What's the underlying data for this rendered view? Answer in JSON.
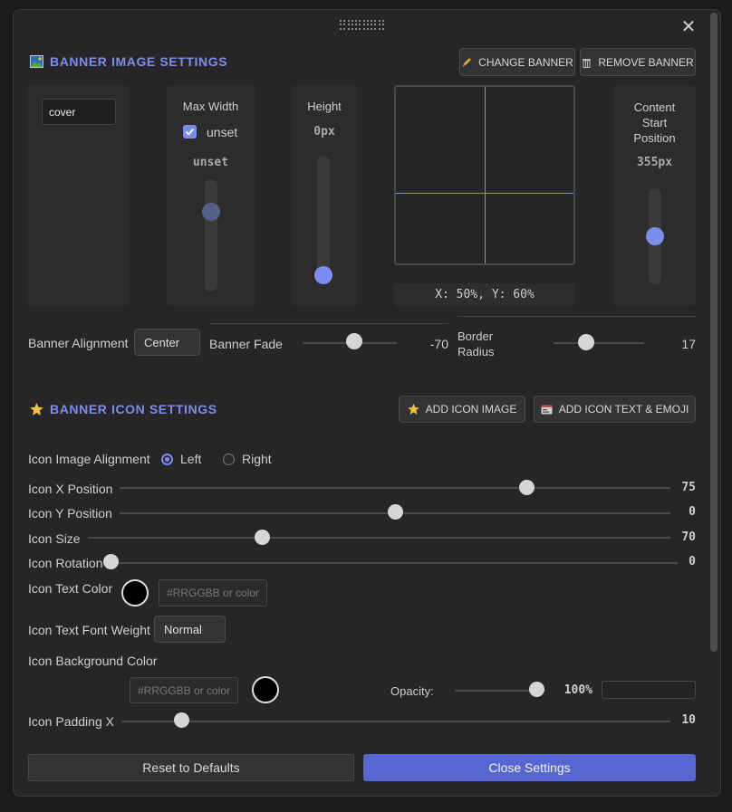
{
  "banner_image": {
    "title": "BANNER IMAGE SETTINGS",
    "change_label": "CHANGE BANNER",
    "remove_label": "REMOVE BANNER",
    "fit_value": "cover",
    "max_width": {
      "label": "Max Width",
      "checkbox_label": "unset",
      "checked": true,
      "value": "unset",
      "level": 0.75
    },
    "height": {
      "label": "Height",
      "value": "0px",
      "level": 0.0
    },
    "position": {
      "readout": "X: 50%, Y: 60%",
      "x": 50,
      "y": 60
    },
    "content_start": {
      "label_line1": "Content",
      "label_line2": "Start",
      "label_line3": "Position",
      "value": "355px",
      "level": 0.5
    },
    "alignment": {
      "label": "Banner Alignment",
      "value": "Center"
    },
    "fade": {
      "label": "Banner Fade",
      "value": "-70",
      "level": 0.55
    },
    "border_radius": {
      "label_line1": "Border",
      "label_line2": "Radius",
      "value": "17",
      "level": 0.36
    }
  },
  "banner_icon": {
    "title": "BANNER ICON SETTINGS",
    "add_image_label": "ADD ICON IMAGE",
    "add_text_label": "ADD ICON TEXT & EMOJI",
    "image_alignment": {
      "label": "Icon Image Alignment",
      "options": [
        "Left",
        "Right"
      ],
      "selected": "Left"
    },
    "x_position": {
      "label": "Icon X Position",
      "value": "75",
      "level": 0.74
    },
    "y_position": {
      "label": "Icon Y Position",
      "value": "0",
      "level": 0.5
    },
    "size": {
      "label": "Icon Size",
      "value": "70",
      "level": 0.3
    },
    "rotation": {
      "label": "Icon Rotation",
      "value": "0",
      "level": 0.0
    },
    "text_color": {
      "label": "Icon Text Color",
      "placeholder": "#RRGGBB or color"
    },
    "font_weight": {
      "label": "Icon Text Font Weight",
      "value": "Normal"
    },
    "background_color": {
      "label": "Icon Background Color",
      "placeholder": "#RRGGBB or color",
      "opacity_label": "Opacity:",
      "opacity_value": "100%",
      "opacity_level": 1.0
    },
    "padding_x": {
      "label": "Icon Padding X",
      "value": "10",
      "level": 0.11
    }
  },
  "footer": {
    "reset_label": "Reset to Defaults",
    "close_label": "Close Settings"
  },
  "colors": {
    "accent": "#7b8ef0",
    "background": "#262626",
    "panel": "#2c2c2c"
  },
  "icons": {
    "close": "close-icon",
    "banner": "picture-icon",
    "icon_section": "star-icon",
    "change": "pencil-icon",
    "remove": "trash-icon"
  }
}
